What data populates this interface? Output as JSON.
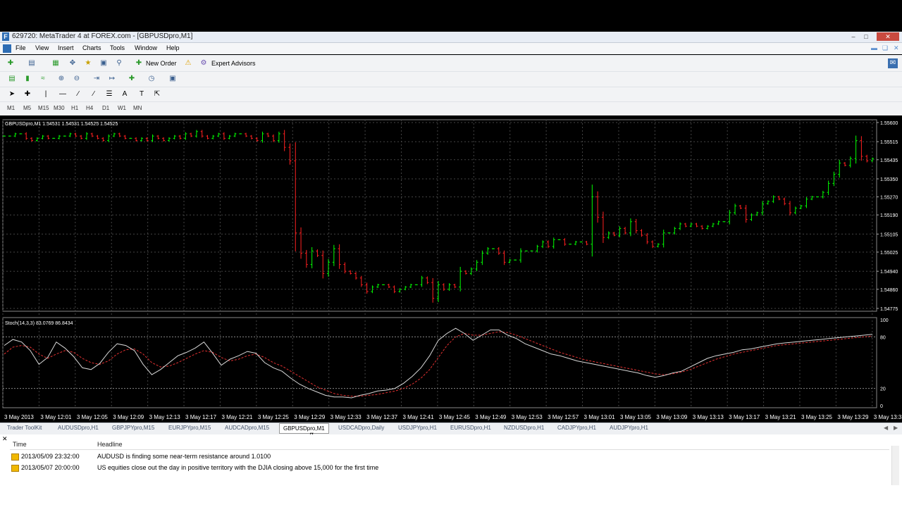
{
  "window": {
    "title": "629720: MetaTrader 4 at FOREX.com - [GBPUSDpro,M1]",
    "icon": "metatrader-logo-icon"
  },
  "menu": [
    "File",
    "View",
    "Insert",
    "Charts",
    "Tools",
    "Window",
    "Help"
  ],
  "toolbar": {
    "new_order_label": "New Order",
    "expert_advisors_label": "Expert Advisors"
  },
  "timeframes": [
    "M1",
    "M5",
    "M15",
    "M30",
    "H1",
    "H4",
    "D1",
    "W1",
    "MN"
  ],
  "chart": {
    "header": "GBPUSDpro,M1  1.54531 1.54531 1.54525 1.54525",
    "indicator_header": "Stoch(14,3,3) 83.0769 86.8434",
    "colors": {
      "up": "#00ff00",
      "down": "#ff2020",
      "grid": "#444444",
      "text": "#ffffff"
    }
  },
  "chart_data": [
    {
      "type": "candlestick",
      "symbol": "GBPUSDpro",
      "timeframe": "M1",
      "y_ticks": [
        "1.55600",
        "1.55515",
        "1.55435",
        "1.55350",
        "1.55270",
        "1.55190",
        "1.55105",
        "1.55025",
        "1.54940",
        "1.54860",
        "1.54775"
      ],
      "ylim": [
        1.54775,
        1.556
      ],
      "x_ticks": [
        "3 May 2013",
        "3 May 12:01",
        "3 May 12:05",
        "3 May 12:09",
        "3 May 12:13",
        "3 May 12:17",
        "3 May 12:21",
        "3 May 12:25",
        "3 May 12:29",
        "3 May 12:33",
        "3 May 12:37",
        "3 May 12:41",
        "3 May 12:45",
        "3 May 12:49",
        "3 May 12:53",
        "3 May 12:57",
        "3 May 13:01",
        "3 May 13:05",
        "3 May 13:09",
        "3 May 13:13",
        "3 May 13:17",
        "3 May 13:21",
        "3 May 13:25",
        "3 May 13:29",
        "3 May 13:33"
      ],
      "close": [
        1.5554,
        1.5554,
        1.5555,
        1.5555,
        1.5553,
        1.5552,
        1.5553,
        1.5554,
        1.5553,
        1.5553,
        1.5554,
        1.5554,
        1.5555,
        1.5554,
        1.5553,
        1.5555,
        1.5554,
        1.5553,
        1.5552,
        1.5554,
        1.5555,
        1.5554,
        1.5553,
        1.5553,
        1.5552,
        1.5553,
        1.5552,
        1.5554,
        1.5553,
        1.5552,
        1.5553,
        1.5554,
        1.5553,
        1.5555,
        1.5554,
        1.5556,
        1.5554,
        1.5553,
        1.5554,
        1.5555,
        1.5553,
        1.5554,
        1.5555,
        1.5555,
        1.5554,
        1.5553,
        1.5552,
        1.5555,
        1.5554,
        1.5552,
        1.5555,
        1.5549,
        1.5543,
        1.5511,
        1.5502,
        1.5497,
        1.5503,
        1.5501,
        1.5493,
        1.5498,
        1.5504,
        1.5497,
        1.5494,
        1.5493,
        1.5491,
        1.5488,
        1.5485,
        1.5487,
        1.5488,
        1.5488,
        1.5487,
        1.5485,
        1.5486,
        1.5487,
        1.5488,
        1.5488,
        1.5491,
        1.5489,
        1.5482,
        1.5488,
        1.5486,
        1.5488,
        1.5487,
        1.5494,
        1.5493,
        1.5495,
        1.5498,
        1.5502,
        1.5504,
        1.5504,
        1.5502,
        1.5498,
        1.5499,
        1.5499,
        1.5503,
        1.5503,
        1.5503,
        1.5505,
        1.5507,
        1.5505,
        1.5508,
        1.5508,
        1.5506,
        1.5506,
        1.5507,
        1.5507,
        1.5506,
        1.5527,
        1.5518,
        1.5509,
        1.5511,
        1.551,
        1.5513,
        1.5511,
        1.5516,
        1.5512,
        1.551,
        1.5507,
        1.5505,
        1.5506,
        1.5511,
        1.5511,
        1.5513,
        1.5515,
        1.5514,
        1.5515,
        1.5514,
        1.5513,
        1.5514,
        1.5515,
        1.5516,
        1.5516,
        1.552,
        1.5523,
        1.5522,
        1.5517,
        1.5519,
        1.552,
        1.5524,
        1.5525,
        1.5527,
        1.5526,
        1.5524,
        1.552,
        1.5522,
        1.5523,
        1.5526,
        1.5527,
        1.5527,
        1.5529,
        1.5533,
        1.5537,
        1.5542,
        1.5541,
        1.5544,
        1.5552,
        1.5545,
        1.5543,
        1.5544
      ],
      "last_price": "1.54525"
    },
    {
      "type": "line",
      "name": "Stoch(14,3,3)",
      "main_value": 83.0769,
      "signal_value": 86.8434,
      "y_ticks": [
        "100",
        "80",
        "20",
        "0"
      ],
      "ylim": [
        0,
        100
      ],
      "levels": [
        80,
        20
      ],
      "main": [
        70,
        77,
        74,
        64,
        48,
        56,
        74,
        67,
        57,
        44,
        42,
        49,
        62,
        72,
        70,
        64,
        48,
        36,
        42,
        50,
        58,
        62,
        67,
        74,
        61,
        47,
        54,
        58,
        63,
        61,
        50,
        44,
        40,
        32,
        25,
        20,
        16,
        12,
        10,
        10,
        9,
        12,
        14,
        17,
        18,
        20,
        26,
        34,
        44,
        58,
        76,
        84,
        90,
        84,
        76,
        82,
        88,
        88,
        82,
        78,
        72,
        68,
        64,
        60,
        58,
        55,
        52,
        50,
        48,
        46,
        44,
        42,
        40,
        38,
        35,
        33,
        35,
        38,
        40,
        45,
        50,
        55,
        58,
        60,
        62,
        65,
        66,
        68,
        70,
        72,
        73,
        74,
        75,
        76,
        77,
        78,
        79,
        80,
        81,
        82,
        83
      ],
      "signal": [
        60,
        68,
        70,
        68,
        60,
        55,
        60,
        64,
        62,
        55,
        50,
        48,
        52,
        60,
        65,
        66,
        60,
        50,
        45,
        46,
        50,
        55,
        60,
        64,
        62,
        56,
        52,
        54,
        58,
        60,
        56,
        50,
        46,
        40,
        34,
        28,
        22,
        18,
        14,
        12,
        11,
        11,
        12,
        13,
        15,
        17,
        20,
        25,
        32,
        42,
        56,
        70,
        80,
        84,
        82,
        82,
        84,
        86,
        85,
        82,
        78,
        74,
        70,
        66,
        62,
        59,
        56,
        53,
        51,
        49,
        47,
        45,
        43,
        41,
        39,
        37,
        36,
        37,
        39,
        42,
        46,
        50,
        54,
        57,
        60,
        62,
        64,
        66,
        68,
        70,
        71,
        72,
        73,
        74,
        75,
        76,
        77,
        78,
        79,
        80,
        81
      ]
    }
  ],
  "tabs": [
    "Trader ToolKit",
    "AUDUSDpro,H1",
    "GBPJPYpro,M15",
    "EURJPYpro,M15",
    "AUDCADpro,M15",
    "GBPUSDpro,M1",
    "USDCADpro,Daily",
    "USDJPYpro,H1",
    "EURUSDpro,H1",
    "NZDUSDpro,H1",
    "CADJPYpro,H1",
    "AUDJPYpro,H1"
  ],
  "active_tab_index": 5,
  "news": {
    "col_time": "Time",
    "col_headline": "Headline",
    "rows": [
      {
        "time": "2013/05/09 23:32:00",
        "headline": "AUDUSD is finding some near-term resistance around 1.0100"
      },
      {
        "time": "2013/05/07 20:00:00",
        "headline": "US equities close out the day in positive territory with the DJIA closing above 15,000 for the first time"
      }
    ]
  }
}
